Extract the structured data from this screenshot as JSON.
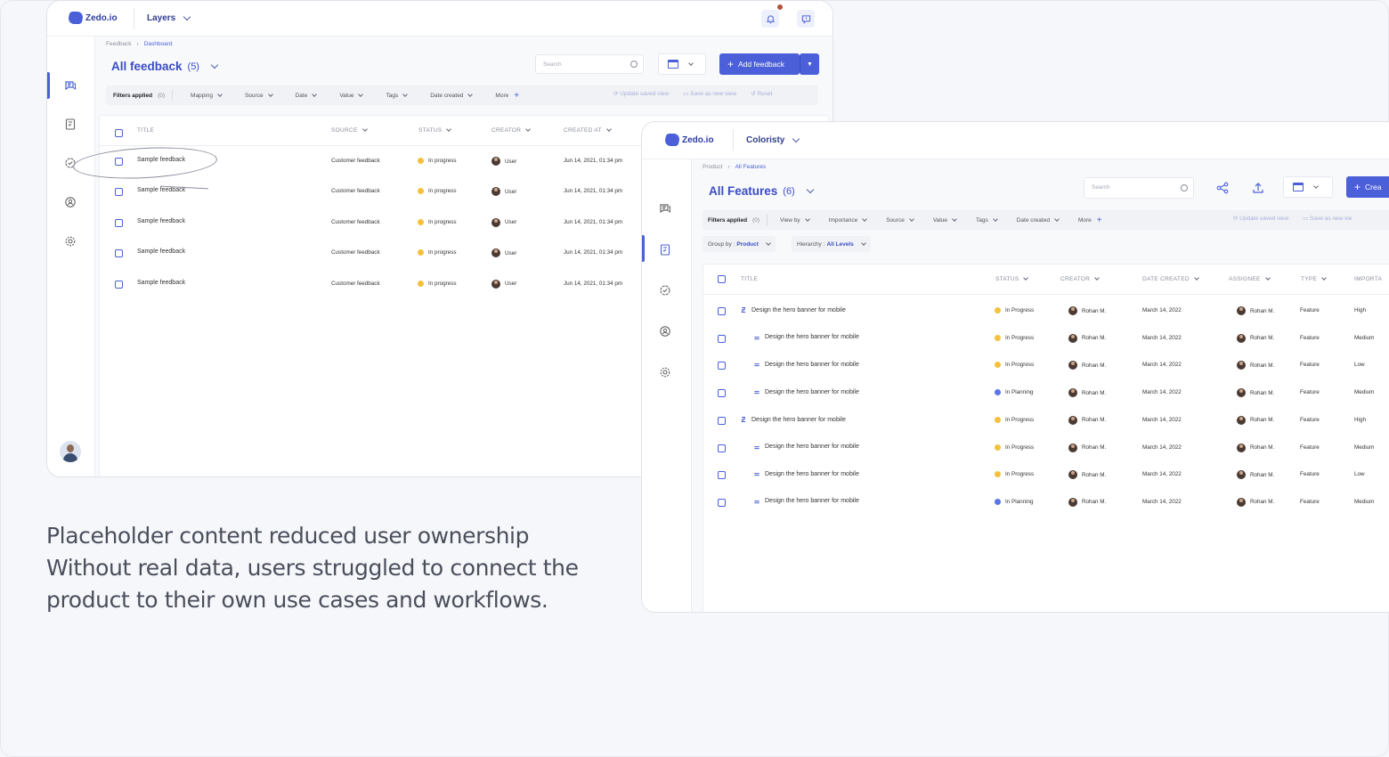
{
  "caption": {
    "line1": "Placeholder content reduced user ownership",
    "line2": "Without real data, users struggled to connect the",
    "line3": "product to their own use cases and workflows."
  },
  "colors": {
    "accent": "#4a5fd8",
    "status_in_progress": "#f5c13a",
    "status_in_planning": "#5b74e8"
  },
  "feedback_window": {
    "logo": "Zedo.io",
    "project": "Layers",
    "breadcrumb": [
      "Feedback",
      "Dashboard"
    ],
    "title": "All feedback",
    "count": "(5)",
    "search_placeholder": "Search",
    "add_button": "Add feedback",
    "filters": {
      "applied_label": "Filters applied",
      "applied_count": "(0)",
      "items": [
        "Mapping",
        "Source",
        "Date",
        "Value",
        "Tags",
        "Date created"
      ],
      "more": "More",
      "update_view": "Update saved view",
      "save_view": "Save as new view",
      "reset": "Reset"
    },
    "columns": [
      "TITLE",
      "SOURCE",
      "STATUS",
      "CREATOR",
      "CREATED AT"
    ],
    "rows": [
      {
        "title": "Sample feedback",
        "source": "Customer feedback",
        "status": "In progress",
        "creator": "User",
        "created": "Jun 14, 2021, 01:34 pm"
      },
      {
        "title": "Sample feedback",
        "source": "Customer feedback",
        "status": "In progress",
        "creator": "User",
        "created": "Jun 14, 2021, 01:34 pm"
      },
      {
        "title": "Sample feedback",
        "source": "Customer feedback",
        "status": "In progress",
        "creator": "User",
        "created": "Jun 14, 2021, 01:34 pm"
      },
      {
        "title": "Sample feedback",
        "source": "Customer feedback",
        "status": "In progress",
        "creator": "User",
        "created": "Jun 14, 2021, 01:34 pm"
      },
      {
        "title": "Sample feedback",
        "source": "Customer feedback",
        "status": "In progress",
        "creator": "User",
        "created": "Jun 14, 2021, 01:34 pm"
      }
    ]
  },
  "features_window": {
    "logo": "Zedo.io",
    "project": "Coloristy",
    "breadcrumb": [
      "Product",
      "All Features"
    ],
    "title": "All Features",
    "count": "(6)",
    "search_placeholder": "Search",
    "create_button": "Crea",
    "filters": {
      "applied_label": "Filters applied",
      "applied_count": "(0)",
      "items": [
        "View by",
        "Importance",
        "Source",
        "Value",
        "Tags",
        "Date created"
      ],
      "more": "More",
      "update_view": "Update saved view",
      "save_view": "Save as new vie"
    },
    "group_by": {
      "label": "Group by :",
      "value": "Product"
    },
    "hierarchy": {
      "label": "Hierarchy :",
      "value": "All Levels"
    },
    "columns": [
      "TITLE",
      "STATUS",
      "CREATOR",
      "DATE CREATED",
      "ASSIGNEE",
      "TYPE",
      "IMPORTA"
    ],
    "rows": [
      {
        "level": "parent",
        "title": "Design the hero banner for mobile",
        "status": "In Progress",
        "creator": "Rohan M.",
        "date": "March 14, 2022",
        "assignee": "Rohan M.",
        "type": "Feature",
        "importance": "High"
      },
      {
        "level": "child",
        "title": "Design the hero banner for mobile",
        "status": "In Progress",
        "creator": "Rohan M.",
        "date": "March 14, 2022",
        "assignee": "Rohan M.",
        "type": "Feature",
        "importance": "Medium"
      },
      {
        "level": "child",
        "title": "Design the hero banner for mobile",
        "status": "In Progress",
        "creator": "Rohan M.",
        "date": "March 14, 2022",
        "assignee": "Rohan M.",
        "type": "Feature",
        "importance": "Low"
      },
      {
        "level": "child",
        "title": "Design the hero banner for mobile",
        "status": "In Planning",
        "creator": "Rohan M.",
        "date": "March 14, 2022",
        "assignee": "Rohan M.",
        "type": "Feature",
        "importance": "Medium"
      },
      {
        "level": "parent",
        "title": "Design the hero banner for mobile",
        "status": "In Progress",
        "creator": "Rohan M.",
        "date": "March 14, 2022",
        "assignee": "Rohan M.",
        "type": "Feature",
        "importance": "High"
      },
      {
        "level": "child",
        "title": "Design the hero banner for mobile",
        "status": "In Progress",
        "creator": "Rohan M.",
        "date": "March 14, 2022",
        "assignee": "Rohan M.",
        "type": "Feature",
        "importance": "Medium"
      },
      {
        "level": "child",
        "title": "Design the hero banner for mobile",
        "status": "In Progress",
        "creator": "Rohan M.",
        "date": "March 14, 2022",
        "assignee": "Rohan M.",
        "type": "Feature",
        "importance": "Low"
      },
      {
        "level": "child",
        "title": "Design the hero banner for mobile",
        "status": "In Planning",
        "creator": "Rohan M.",
        "date": "March 14, 2022",
        "assignee": "Rohan M.",
        "type": "Feature",
        "importance": "Medium"
      }
    ]
  }
}
